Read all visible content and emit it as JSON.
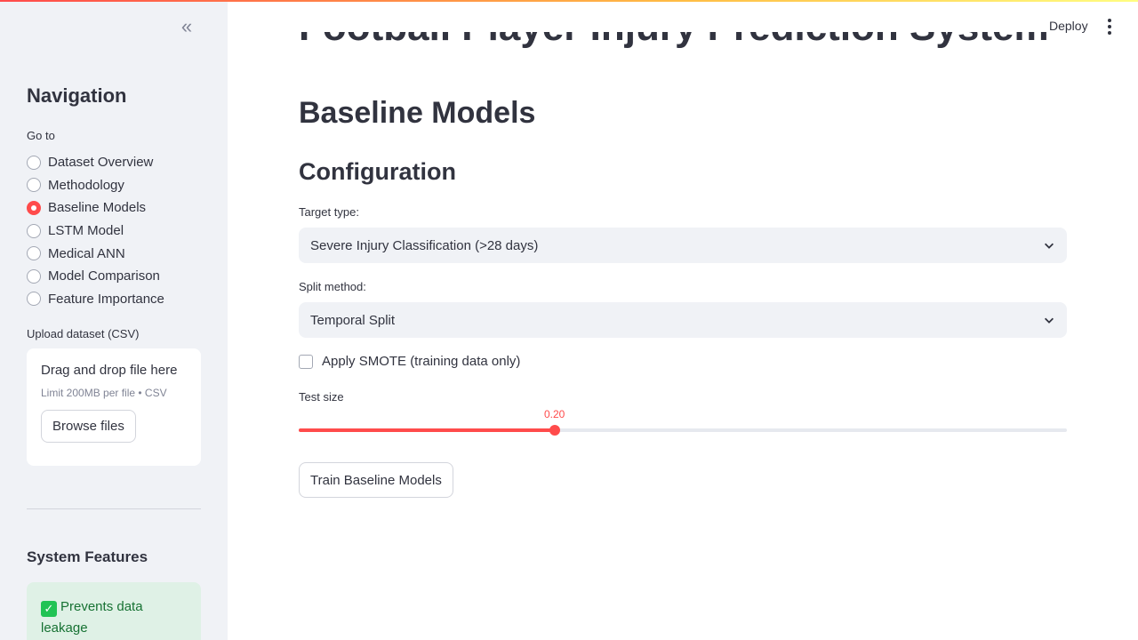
{
  "header": {
    "deploy_label": "Deploy",
    "menu_icon": "kebab-menu-icon",
    "accent_gradient": [
      "#ff4b4b",
      "#ffbd45",
      "#fffd80"
    ]
  },
  "sidebar": {
    "collapse_icon": "double-chevron-left-icon",
    "title": "Navigation",
    "goto_label": "Go to",
    "radio_options": [
      {
        "label": "Dataset Overview",
        "selected": false
      },
      {
        "label": "Methodology",
        "selected": false
      },
      {
        "label": "Baseline Models",
        "selected": true
      },
      {
        "label": "LSTM Model",
        "selected": false
      },
      {
        "label": "Medical ANN",
        "selected": false
      },
      {
        "label": "Model Comparison",
        "selected": false
      },
      {
        "label": "Feature Importance",
        "selected": false
      }
    ],
    "upload": {
      "label": "Upload dataset (CSV)",
      "dropzone_title": "Drag and drop file here",
      "dropzone_limit": "Limit 200MB per file • CSV",
      "browse_label": "Browse files"
    },
    "features": {
      "title": "System Features",
      "items": [
        {
          "icon": "check-mark-icon",
          "text": "Prevents data leakage"
        }
      ]
    }
  },
  "main": {
    "app_title": "Football Player Injury Prediction System",
    "page_heading": "Baseline Models",
    "section_heading": "Configuration",
    "target_type": {
      "label": "Target type:",
      "value": "Severe Injury Classification (>28 days)"
    },
    "split_method": {
      "label": "Split method:",
      "value": "Temporal Split"
    },
    "smote": {
      "label": "Apply SMOTE (training data only)",
      "checked": false
    },
    "test_size": {
      "label": "Test size",
      "value_text": "0.20",
      "fraction_of_range": 0.333
    },
    "train_button_label": "Train Baseline Models"
  },
  "colors": {
    "accent": "#ff4b4b",
    "sidebar_bg": "#f0f2f6",
    "success_bg": "#dff1e6",
    "success_text": "#177233"
  }
}
